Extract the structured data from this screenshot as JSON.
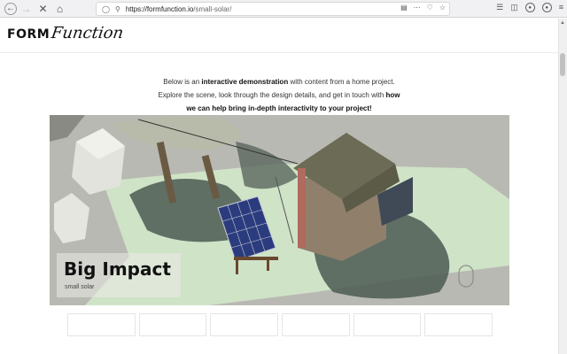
{
  "browser": {
    "url_host": "https://formfunction.io",
    "url_path": "/small-solar/"
  },
  "logo": {
    "form": "FORM",
    "function": "Function"
  },
  "intro": {
    "line1_pre": "Below is an ",
    "line1_bold": "interactive demonstration",
    "line1_post": " with content from a home project.",
    "line2_pre": "Explore the scene, look through the design details, and get in touch with ",
    "line2_bold": "how",
    "line3_bold": "we can help bring in-depth interactivity to your project!"
  },
  "scene": {
    "title": "Big Impact",
    "subtitle": "small solar"
  },
  "colors": {
    "ground": "#b9b9b3",
    "lawn": "#cfe3c7",
    "panel": "#2b3c7e",
    "house_wall": "#8f7f6b",
    "roof": "#6c6b56",
    "chimney": "#b06a5e"
  }
}
